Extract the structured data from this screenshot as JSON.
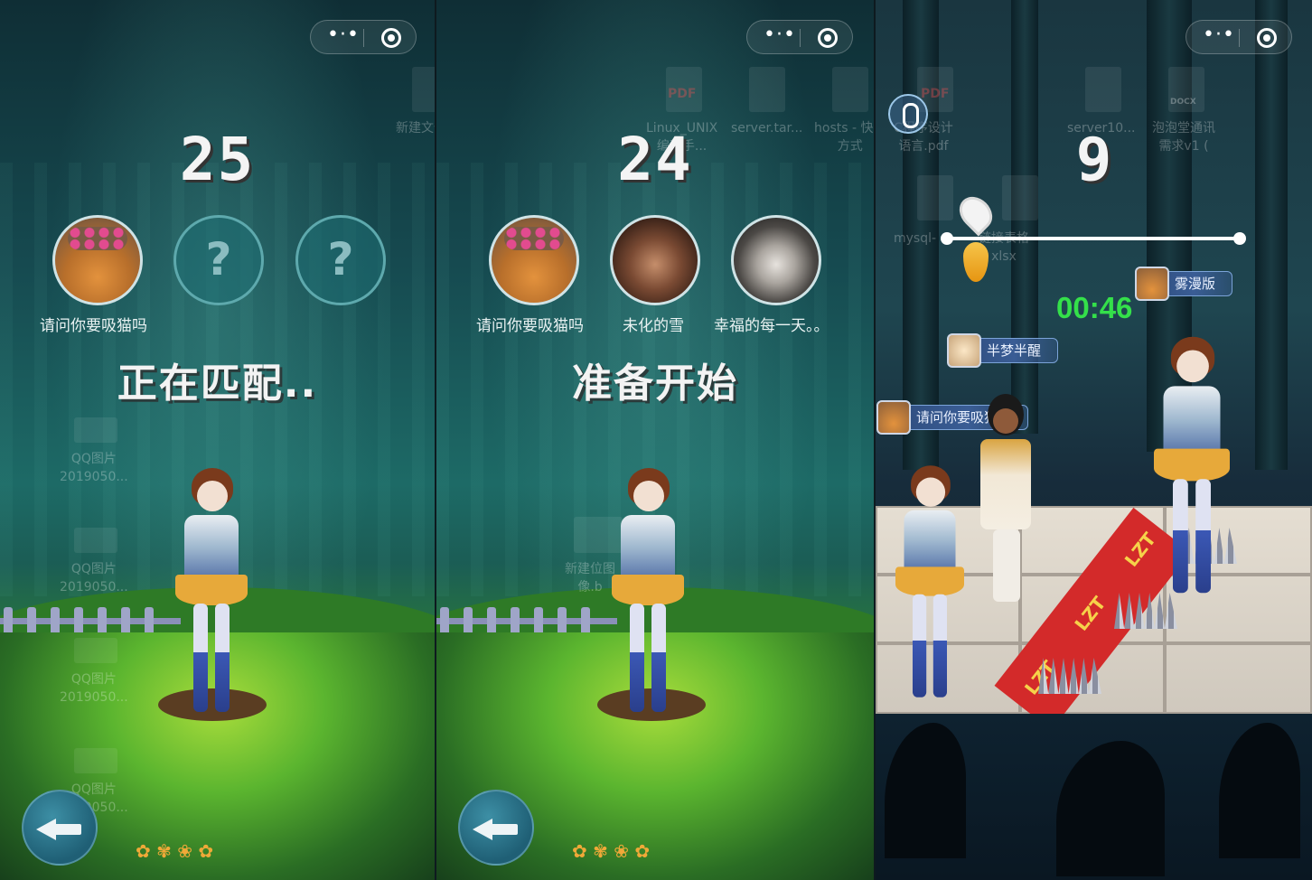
{
  "panel1": {
    "countdown": "25",
    "players": [
      {
        "name": "请问你要吸猫吗",
        "avatar": "cat-avatar",
        "known": true
      },
      {
        "name": "",
        "avatar": "unknown",
        "known": false,
        "placeholder": "?"
      },
      {
        "name": "",
        "avatar": "unknown",
        "known": false,
        "placeholder": "?"
      }
    ],
    "status": "正在匹配..",
    "desktop_labels": [
      "新建文件夹",
      "QQ图片\n2019050...",
      "QQ图片\n2019050...",
      "QQ图片\n2019050...",
      "QQ图片\n2019050..."
    ]
  },
  "panel2": {
    "countdown": "24",
    "players": [
      {
        "name": "请问你要吸猫吗",
        "avatar": "cat-avatar"
      },
      {
        "name": "未化的雪",
        "avatar": "man-avatar-1"
      },
      {
        "name": "幸福的每一天。。",
        "avatar": "man-avatar-2"
      }
    ],
    "status": "准备开始",
    "desktop_labels": [
      "Linux_UNIX\n编程手...",
      "server.tar...",
      "hosts - 快捷\n方式",
      "新建位图\n像.b"
    ],
    "pdf_badge": "PDF"
  },
  "panel3": {
    "countdown": "9",
    "timer": "00:46",
    "progress_fraction": 0.1,
    "player_tags": [
      {
        "name": "雾漫版",
        "avatar": "anime-avatar"
      },
      {
        "name": "半梦半醒",
        "avatar": "smiley-avatar"
      },
      {
        "name": "请问你要吸猫吗",
        "avatar": "cat-avatar"
      }
    ],
    "carpet_text": "LZT",
    "desktop_labels": [
      "C程序设计\n语言.pdf",
      "server10...",
      "泡泡堂通讯\n需求v1 (",
      "mysql-",
      "链接表格\nxlsx"
    ],
    "pdf_badge": "PDF",
    "docx_badge": "DOCX"
  },
  "icons": {
    "menu": "more-dots-icon",
    "close": "target-circle-icon",
    "back": "back-arrow-icon",
    "voice": "phone-icon",
    "location": "map-pin-icon",
    "drop": "water-drop-icon"
  },
  "colors": {
    "timer": "#34e04a",
    "tag_bg": "#3a5d95",
    "carpet": "#d32a2a"
  }
}
